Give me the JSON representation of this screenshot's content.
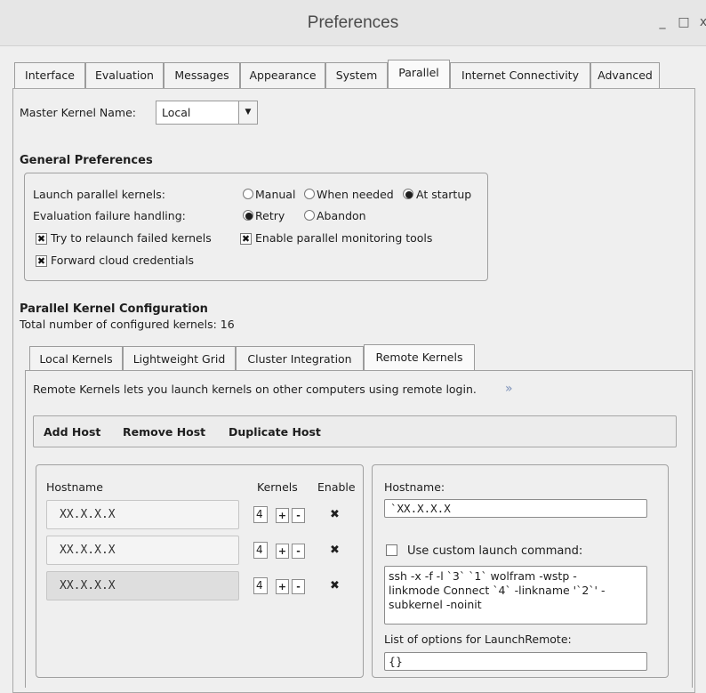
{
  "window": {
    "title": "Preferences",
    "min_glyph": "_",
    "max_glyph": "□",
    "close_glyph": "x"
  },
  "tabs": [
    "Interface",
    "Evaluation",
    "Messages",
    "Appearance",
    "System",
    "Parallel",
    "Internet Connectivity",
    "Advanced"
  ],
  "active_tab": "Parallel",
  "master_kernel": {
    "label": "Master Kernel Name:",
    "value": "Local"
  },
  "general": {
    "heading": "General Preferences",
    "launch_label": "Launch parallel kernels:",
    "launch_options": [
      "Manual",
      "When needed",
      "At startup"
    ],
    "launch_selected": "At startup",
    "eval_label": "Evaluation failure handling:",
    "eval_options": [
      "Retry",
      "Abandon"
    ],
    "eval_selected": "Retry",
    "relaunch_label": "Try  to relaunch failed kernels",
    "relaunch_checked": true,
    "monitor_label": "Enable parallel monitoring tools",
    "monitor_checked": true,
    "cloud_label": "Forward cloud credentials",
    "cloud_checked": true
  },
  "kernel_config": {
    "heading": "Parallel Kernel Configuration",
    "total": "Total  number  of configured kernels: 16"
  },
  "subtabs": [
    "Local Kernels",
    "Lightweight Grid",
    "Cluster Integration",
    "Remote Kernels"
  ],
  "active_subtab": "Remote Kernels",
  "remote": {
    "description": "Remote Kernels lets you launch kernels on other computers using remote login.",
    "more_glyph": "»",
    "toolbar": {
      "add": "Add Host",
      "remove": "Remove Host",
      "duplicate": "Duplicate Host"
    },
    "columns": {
      "hostname": "Hostname",
      "kernels": "Kernels",
      "enable": "Enable"
    },
    "hosts": [
      {
        "hostname": "XX.X.X.X",
        "kernels": "4",
        "enabled": true
      },
      {
        "hostname": "XX.X.X.X",
        "kernels": "4",
        "enabled": true
      },
      {
        "hostname": "XX.X.X.X",
        "kernels": "4",
        "enabled": true
      }
    ],
    "plus_glyph": "+",
    "minus_glyph": "-",
    "detail": {
      "hostname_label": "Hostname:",
      "hostname_value": "`XX.X.X.X",
      "custom_label": "Use custom launch command:",
      "custom_checked": false,
      "command_lines": [
        "ssh -x -f -l `3` `1` wolfram -wstp -",
        "linkmode Connect `4` -linkname '`2`' -",
        "subkernel -noinit"
      ],
      "options_label": "List of options for LaunchRemote:",
      "options_value": "{}"
    }
  }
}
